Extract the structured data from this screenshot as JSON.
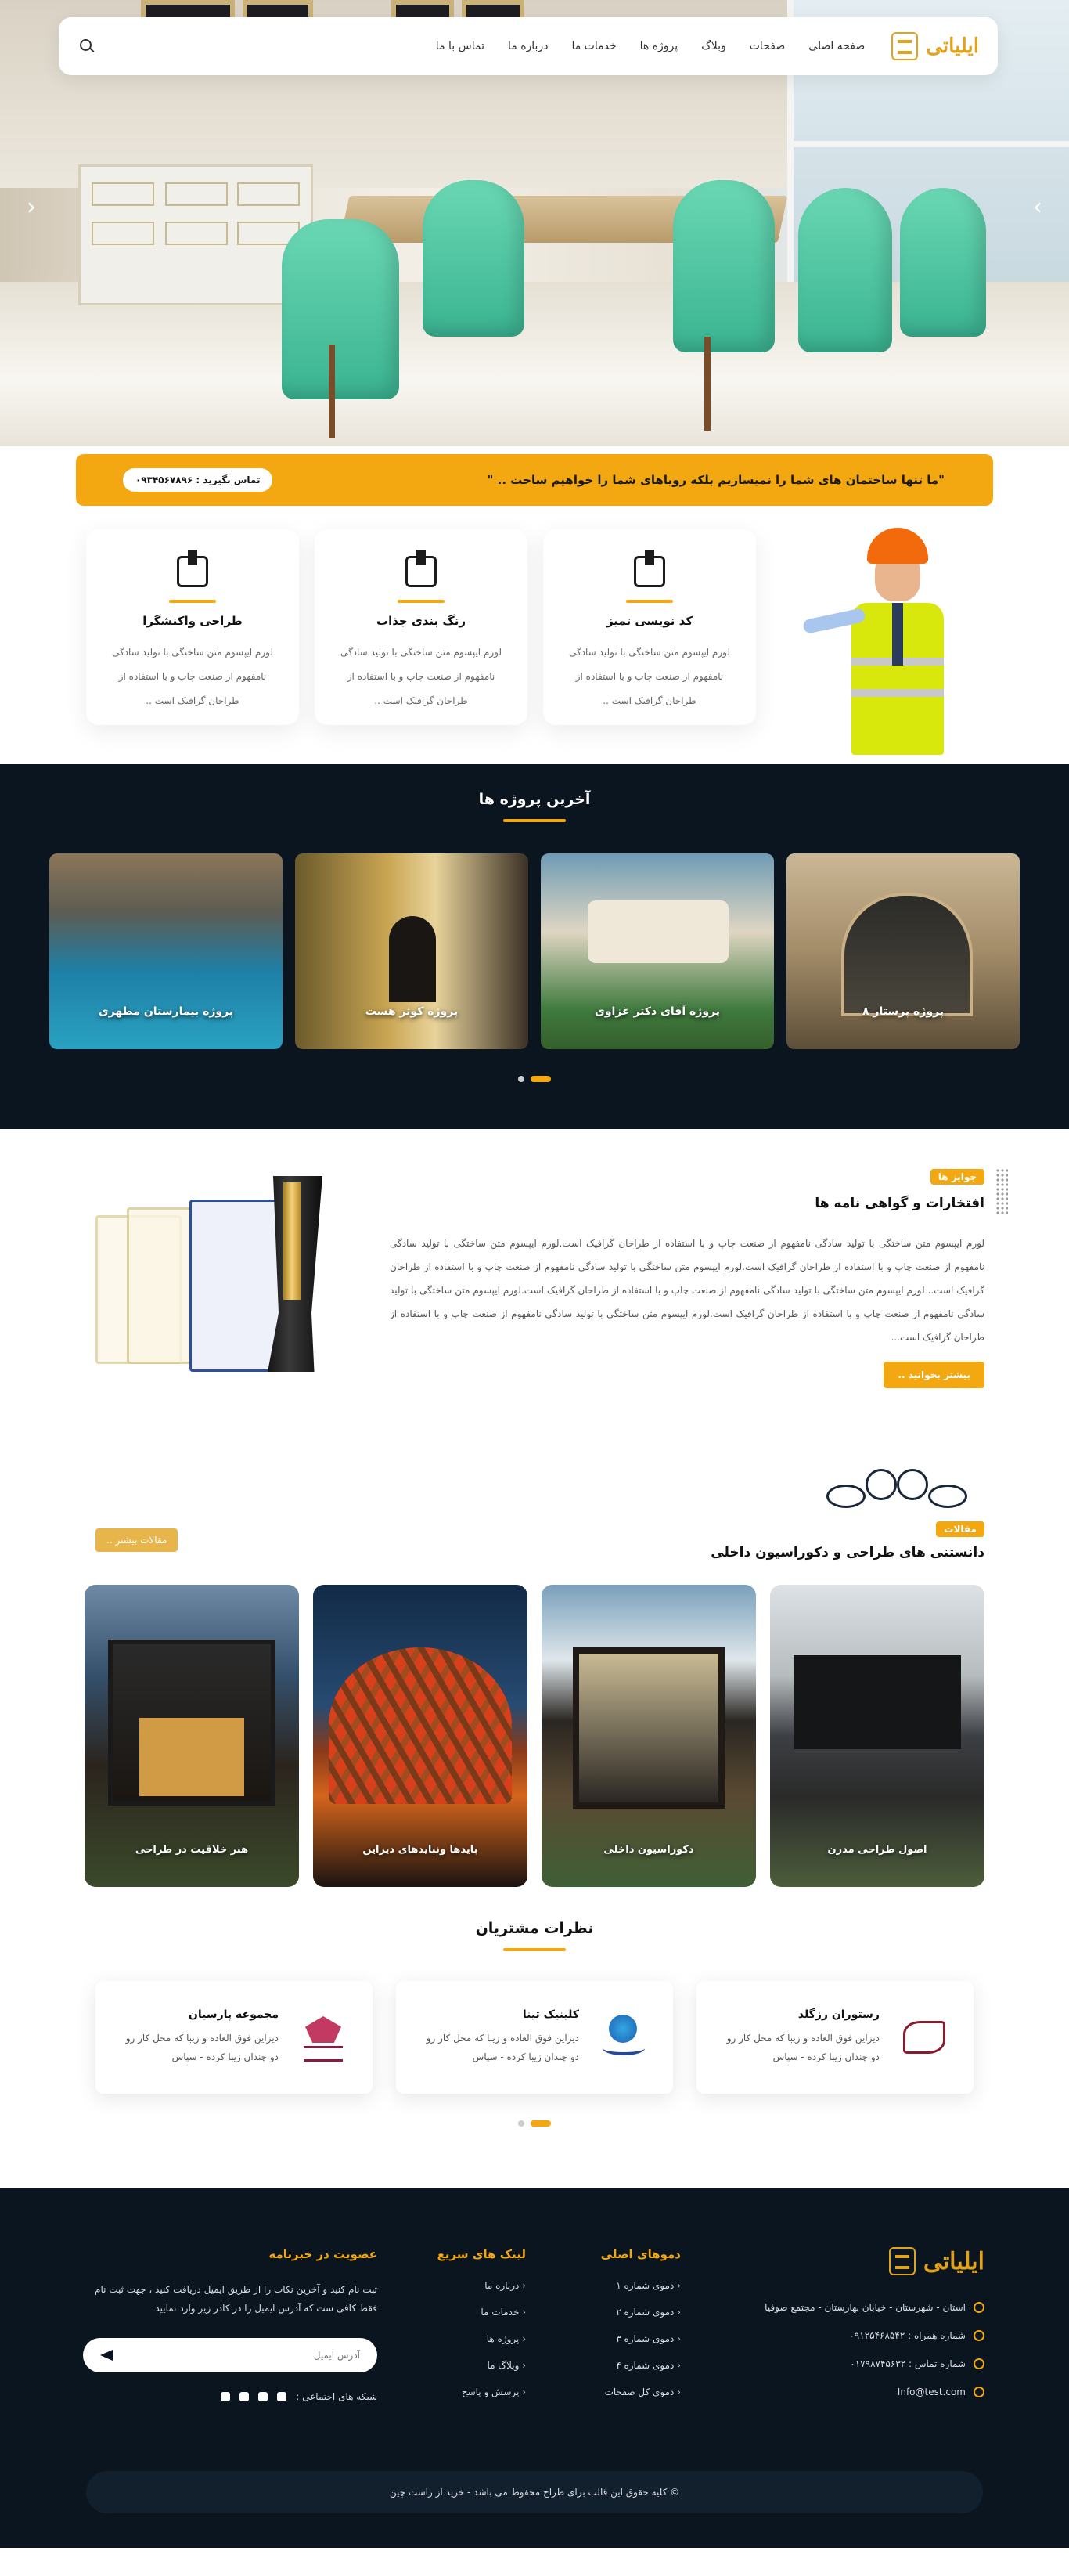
{
  "nav": {
    "logo_text": "ایلیاتی",
    "menu": [
      "صفحه اصلی",
      "صفحات",
      "وبلاگ",
      "پروژه ها",
      "خدمات ما",
      "درباره ما",
      "تماس با ما"
    ]
  },
  "hero": {
    "prev_arrow": "‹",
    "next_arrow": "›"
  },
  "quote_bar": {
    "text": "\"ما تنها ساختمان های شما را نمیسازیم بلکه رویاهای شما را خواهیم ساخت .. \"",
    "call": "تماس بگیرید : ۰۹۳۴۵۶۷۸۹۶"
  },
  "services": [
    {
      "title": "کد نویسی تمیز",
      "text": "لورم ایپسوم متن ساختگی با تولید سادگی نامفهوم از صنعت چاپ و با استفاده از طراحان گرافیک است .."
    },
    {
      "title": "رنگ بندی جذاب",
      "text": "لورم ایپسوم متن ساختگی با تولید سادگی نامفهوم از صنعت چاپ و با استفاده از طراحان گرافیک است .."
    },
    {
      "title": "طراحی واکنشگرا",
      "text": "لورم ایپسوم متن ساختگی با تولید سادگی نامفهوم از صنعت چاپ و با استفاده از طراحان گرافیک است .."
    }
  ],
  "projects": {
    "title": "آخرین پروژه ها",
    "items": [
      "پروژه پرستار ۸",
      "پروژه آقای دکتر غزاوی",
      "پروژه کوثر هست",
      "پروژه بیمارستان مطهری"
    ]
  },
  "awards": {
    "tag": "جوایز ها",
    "title": "افتخارات و گواهی نامه ها",
    "body": "لورم ایپسوم متن ساختگی با تولید سادگی نامفهوم از صنعت چاپ و با استفاده از طراحان گرافیک است.لورم ایپسوم متن ساختگی با تولید سادگی نامفهوم از صنعت چاپ و با استفاده از طراحان گرافیک است.لورم ایپسوم متن ساختگی با تولید سادگی نامفهوم از صنعت چاپ و با استفاده از طراحان گرافیک است.. لورم ایپسوم متن ساختگی با تولید سادگی نامفهوم از صنعت چاپ و با استفاده از طراحان گرافیک است.لورم ایپسوم متن ساختگی با تولید سادگی نامفهوم از صنعت چاپ و با استفاده از طراحان گرافیک است.لورم ایپسوم متن ساختگی با تولید سادگی نامفهوم از صنعت چاپ و با استفاده از طراحان گرافیک است...",
    "button": "بیشتر بخوانید .."
  },
  "articles": {
    "tag": "مقالات",
    "title": "دانستنی های طراحی و دکوراسیون داخلی",
    "more": "مقالات بیشتر ..",
    "items": [
      "اصول طراحی مدرن",
      "دکوراسیون داخلی",
      "بایدها ونبایدهای دیزاین",
      "هنر خلاقیت در طراحی"
    ]
  },
  "testimonials": {
    "title": "نظرات مشتریان",
    "items": [
      {
        "name": "رستوران رزگلد",
        "text": "دیزاین فوق العاده و زیبا که محل کار رو دو چندان زیبا کرده - سپاس"
      },
      {
        "name": "کلینیک تینا",
        "text": "دیزاین فوق العاده و زیبا که محل کار رو دو چندان زیبا کرده - سپاس"
      },
      {
        "name": "مجموعه پارسیان",
        "text": "دیزاین فوق العاده و زیبا که محل کار رو دو چندان زیبا کرده - سپاس"
      }
    ]
  },
  "footer": {
    "logo_text": "ایلیاتی",
    "address": "استان - شهرستان - خیابان بهارستان - مجتمع صوفیا",
    "mobile": "شماره همراه : ۰۹۱۲۵۴۶۸۵۴۲",
    "phone": "شماره تماس : ۰۱۷۹۸۷۴۵۶۳۲",
    "email": "Info@test.com",
    "demos_title": "دموهای اصلی",
    "demos": [
      "دموی شماره ۱",
      "دموی شماره ۲",
      "دموی شماره ۳",
      "دموی شماره ۴",
      "دموی کل صفحات"
    ],
    "links_title": "لینک های سریع",
    "links": [
      "درباره ما",
      "خدمات ما",
      "پروژه ها",
      "وبلاگ ما",
      "پرسش و پاسخ"
    ],
    "news_title": "عضویت در خبرنامه",
    "news_text": "ثبت نام کنید و آخرین نکات را از طریق ایمیل دریافت کنید ، جهت ثبت نام فقط کافی ست که آدرس ایمیل را در کادر زیر وارد نمایید",
    "email_placeholder": "آدرس ایمیل",
    "social_label": "شبکه های اجتماعی :",
    "copyright": "© کلیه حقوق این قالب برای طراح محفوظ می باشد - خرید از راست چین"
  },
  "colors": {
    "accent": "#f3a711",
    "dark": "#0b151f"
  }
}
